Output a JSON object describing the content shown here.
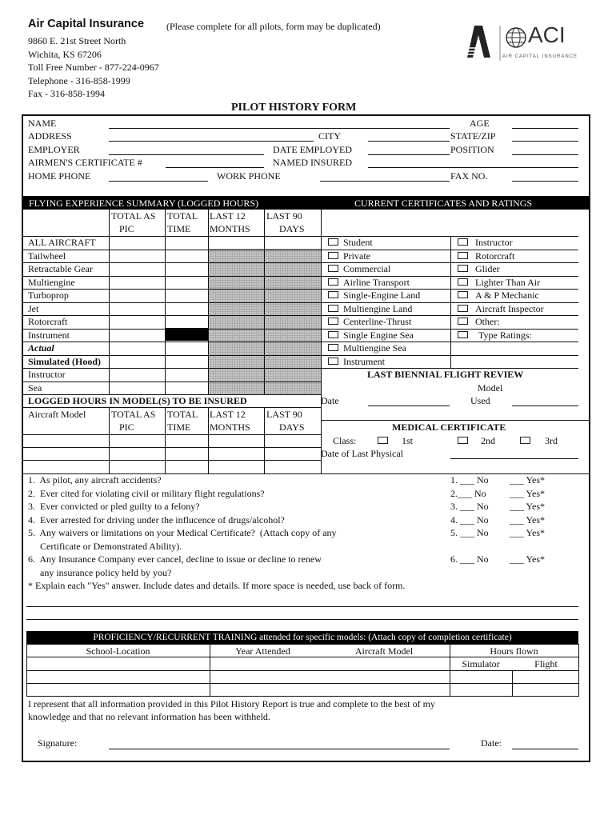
{
  "header": {
    "company": "Air Capital Insurance",
    "note": "(Please complete for all pilots, form may be duplicated)",
    "address_line1": "9860 E. 21st Street North",
    "address_line2": "Wichita, KS 67206",
    "toll_free": "Toll Free Number - 877-224-0967",
    "telephone": "Telephone - 316-858-1999",
    "fax": "Fax - 316-858-1994",
    "logo_text": "ACI",
    "logo_subtext": "AIR CAPITAL INSURANCE"
  },
  "title": "PILOT HISTORY FORM",
  "personal": {
    "name": "NAME",
    "age": "AGE",
    "address": "ADDRESS",
    "city": "CITY",
    "state_zip": "STATE/ZIP",
    "employer": "EMPLOYER",
    "date_employed": "DATE EMPLOYED",
    "position": "POSITION",
    "airmen_cert": "AIRMEN'S CERTIFICATE #",
    "named_insured": "NAMED INSURED",
    "home_phone": "HOME PHONE",
    "work_phone": "WORK PHONE",
    "fax_no": "FAX NO."
  },
  "experience": {
    "bar_title": "FLYING EXPERIENCE SUMMARY (LOGGED HOURS)",
    "columns": [
      [
        "TOTAL AS",
        "PIC"
      ],
      [
        "TOTAL",
        "TIME"
      ],
      [
        "LAST 12",
        "MONTHS"
      ],
      [
        "LAST 90",
        "DAYS"
      ]
    ],
    "rows": [
      "ALL AIRCRAFT",
      "Tailwheel",
      "Retractable Gear",
      "Multiengine",
      "Turboprop",
      "Jet",
      "Rotorcraft",
      "Instrument",
      "Actual",
      "Simulated (Hood)",
      "Instructor",
      "Sea"
    ],
    "model_title": "LOGGED HOURS IN MODEL(S) TO BE INSURED",
    "model_first_col": "Aircraft Model"
  },
  "certificates": {
    "bar_title": "CURRENT CERTIFICATES AND RATINGS",
    "left": [
      "Student",
      "Private",
      "Commercial",
      "Airline Transport",
      "Single-Engine Land",
      "Multiengine Land",
      "Centerline-Thrust",
      "Single Engine Sea",
      "Multiengine Sea",
      "Instrument"
    ],
    "right": [
      "Instructor",
      "Rotorcraft",
      "Glider",
      "Lighter Than Air",
      "A & P Mechanic",
      "Aircraft Inspector",
      "Other:",
      "Type Ratings:"
    ]
  },
  "biennial": {
    "title": "LAST BIENNIAL FLIGHT REVIEW",
    "date": "Date",
    "model1": "Model",
    "model2": "Used"
  },
  "medical": {
    "title": "MEDICAL CERTIFICATE",
    "class": "Class:",
    "first": "1st",
    "second": "2nd",
    "third": "3rd",
    "last_physical": "Date of Last Physical"
  },
  "questions": {
    "items": [
      {
        "text": "1.  As pilot, any aircraft accidents?",
        "no": "1. ___ No",
        "yes": "___ Yes*"
      },
      {
        "text": "2.  Ever cited for violating civil or military flight regulations?",
        "no": "2.___ No",
        "yes": "___ Yes*"
      },
      {
        "text": "3.  Ever convicted or pled guilty to a felony?",
        "no": "3. ___ No",
        "yes": "___ Yes*"
      },
      {
        "text": "4.  Ever arrested for driving under the influcence of drugs/alcohol?",
        "no": "4. ___ No",
        "yes": "___ Yes*"
      },
      {
        "text": "5.  Any waivers or limitations on your Medical Certificate?  (Attach copy of any",
        "no": "5. ___ No",
        "yes": "___ Yes*"
      },
      {
        "text": "     Certificate or Demonstrated Ability).",
        "no": "",
        "yes": ""
      },
      {
        "text": "6.  Any Insurance Company ever cancel, decline to issue or decline to renew",
        "no": "6. ___ No",
        "yes": "___ Yes*"
      },
      {
        "text": "     any insurance policy held by you?",
        "no": "",
        "yes": ""
      }
    ],
    "explain": "* Explain each \"Yes\" answer.  Include dates and details.  If more space is needed, use back of form."
  },
  "training": {
    "bar_title": "PROFICIENCY/RECURRENT TRAINING attended for specific models:  (Attach copy of completion certificate)",
    "school": "School-Location",
    "year": "Year Attended",
    "model": "Aircraft Model",
    "hours": "Hours flown",
    "simulator": "Simulator",
    "flight": "Flight"
  },
  "declaration": {
    "line1": "I represent that all information provided in this Pilot History Report is true and complete to the best of my",
    "line2": "knowledge and that no relevant information has been withheld.",
    "signature": "Signature:",
    "date": "Date:"
  }
}
